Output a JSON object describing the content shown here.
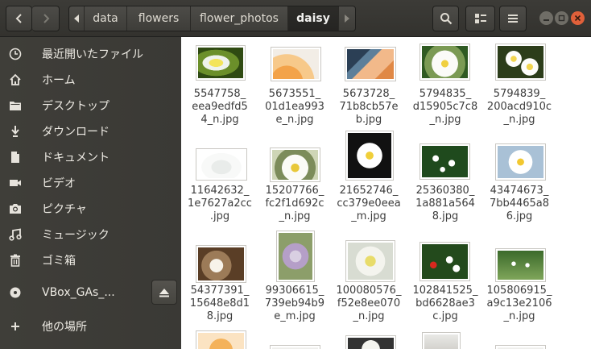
{
  "header": {
    "path": [
      "data",
      "flowers",
      "flower_photos",
      "daisy"
    ],
    "active_crumb": "daisy"
  },
  "sidebar": {
    "items": [
      {
        "label": "最近開いたファイル",
        "icon": "clock-icon"
      },
      {
        "label": "ホーム",
        "icon": "home-icon"
      },
      {
        "label": "デスクトップ",
        "icon": "folder-icon"
      },
      {
        "label": "ダウンロード",
        "icon": "download-icon"
      },
      {
        "label": "ドキュメント",
        "icon": "document-icon"
      },
      {
        "label": "ビデオ",
        "icon": "video-icon"
      },
      {
        "label": "ピクチャ",
        "icon": "camera-icon"
      },
      {
        "label": "ミュージック",
        "icon": "music-icon"
      },
      {
        "label": "ゴミ箱",
        "icon": "trash-icon"
      },
      {
        "label": "VBox_GAs_...",
        "icon": "disc-icon"
      },
      {
        "label": "他の場所",
        "icon": "plus-icon"
      }
    ]
  },
  "files": [
    {
      "lines": [
        "5547758_",
        "eea9edfd5",
        "4_n.jpg"
      ],
      "image": "im-bee"
    },
    {
      "lines": [
        "5673551_",
        "01d1ea993",
        "e_n.jpg"
      ],
      "image": "im-orange"
    },
    {
      "lines": [
        "5673728_",
        "71b8cb57e",
        "b.jpg"
      ],
      "image": "im-peach"
    },
    {
      "lines": [
        "5794835_",
        "d15905c7c8",
        "_n.jpg"
      ],
      "image": "im-white1"
    },
    {
      "lines": [
        "5794839_",
        "200acd910c",
        "_n.jpg"
      ],
      "image": "im-white2"
    },
    {
      "lines": [
        "11642632_",
        "1e7627a2cc",
        ".jpg"
      ],
      "image": "im-soft"
    },
    {
      "lines": [
        "15207766_",
        "fc2f1d692c",
        "_n.jpg"
      ],
      "image": "im-white3"
    },
    {
      "lines": [
        "21652746_",
        "cc379e0eea",
        "_m.jpg"
      ],
      "image": "im-black"
    },
    {
      "lines": [
        "25360380_",
        "1a881a564",
        "8.jpg"
      ],
      "image": "im-field"
    },
    {
      "lines": [
        "43474673_",
        "7bb4465a8",
        "6.jpg"
      ],
      "image": "im-sky"
    },
    {
      "lines": [
        "54377391_",
        "15648e8d1",
        "8.jpg"
      ],
      "image": "im-brown"
    },
    {
      "lines": [
        "99306615_",
        "739eb94b9",
        "e_m.jpg"
      ],
      "image": "im-lilac"
    },
    {
      "lines": [
        "100080576_",
        "f52e8ee070",
        "_n.jpg"
      ],
      "image": "im-big"
    },
    {
      "lines": [
        "102841525_",
        "bd6628ae3",
        "c.jpg"
      ],
      "image": "im-red"
    },
    {
      "lines": [
        "105806915_",
        "a9c13e2106",
        "_n.jpg"
      ],
      "image": "im-meadow"
    }
  ]
}
